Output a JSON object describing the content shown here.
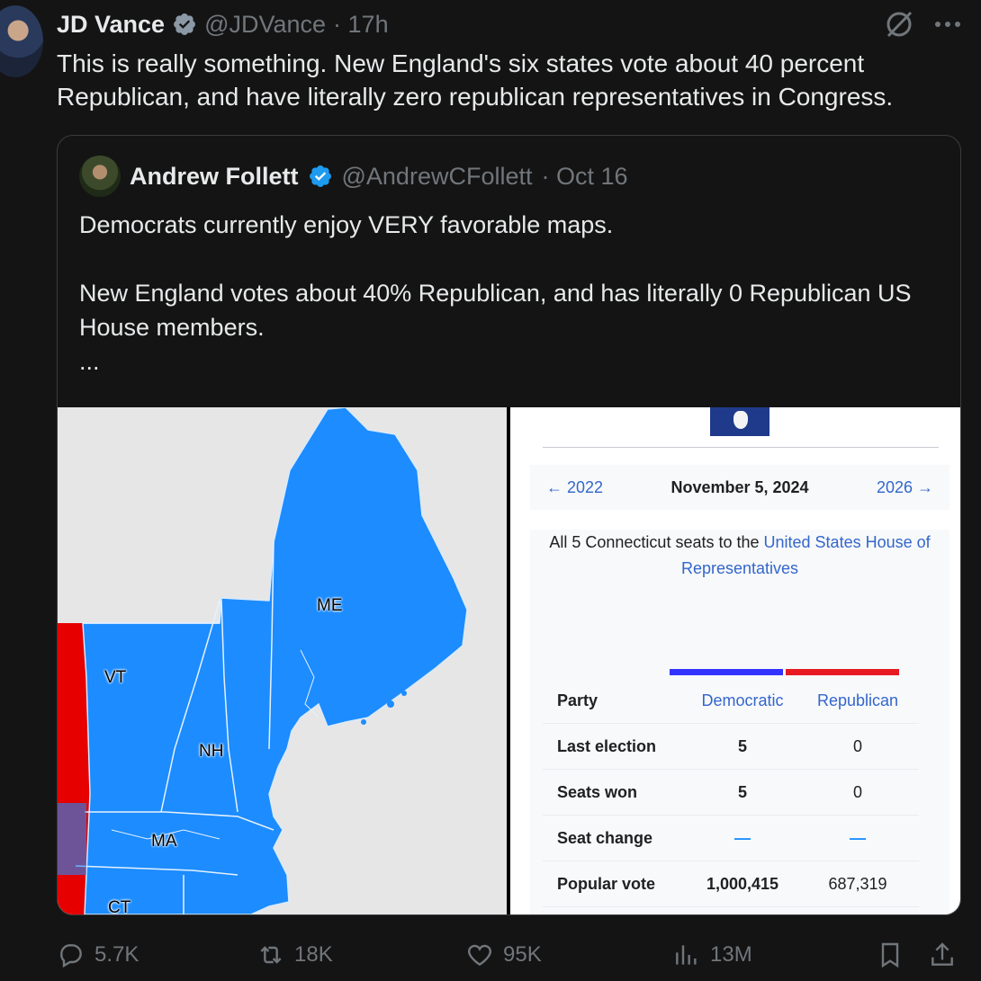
{
  "tweet": {
    "author_name": "JD Vance",
    "handle": "@JDVance",
    "time": "· 17h",
    "text": "This is really something. New England's six states vote about 40 percent Republican, and have literally zero republican representatives in Congress."
  },
  "quote": {
    "author_name": "Andrew Follett",
    "handle": "@AndrewCFollett",
    "time": "· Oct 16",
    "text": "Democrats currently enjoy VERY favorable maps.\n\nNew England votes about 40% Republican, and has literally 0 Republican US House members.\n...",
    "map_labels": {
      "me": "ME",
      "vt": "VT",
      "nh": "NH",
      "ma": "MA",
      "ct": "CT"
    },
    "wiki": {
      "prev_link": "← 2022",
      "date": "November 5, 2024",
      "next_link": "2026 →",
      "desc_prefix": "All 5 Connecticut seats to the ",
      "desc_link": "United States House of Representatives",
      "header": {
        "label": "Party",
        "dem": "Democratic",
        "rep": "Republican"
      },
      "rows": [
        {
          "label": "Last election",
          "dem": "5",
          "rep": "0"
        },
        {
          "label": "Seats won",
          "dem": "5",
          "rep": "0"
        },
        {
          "label": "Seat change",
          "dem": "—",
          "rep": "—"
        },
        {
          "label": "Popular vote",
          "dem": "1,000,415",
          "rep": "687,319"
        }
      ],
      "colors": {
        "dem": "#3333ff",
        "rep": "#e81b23"
      }
    }
  },
  "actions": {
    "replies": "5.7K",
    "reposts": "18K",
    "likes": "95K",
    "views": "13M"
  },
  "colors": {
    "map_blue": "#1c8cff",
    "map_red": "#e60000",
    "verified": "#1d9bf0"
  }
}
